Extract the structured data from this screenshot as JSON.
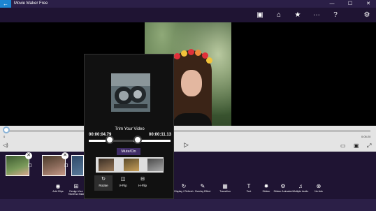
{
  "window": {
    "title": "Movie Maker Free",
    "back_glyph": "←",
    "minimize_glyph": "—",
    "maximize_glyph": "☐",
    "close_glyph": "✕"
  },
  "toolbar": {
    "icons": [
      "save-icon",
      "home-icon",
      "star-icon",
      "more-icon",
      "help-icon",
      "settings-icon"
    ],
    "glyphs": [
      "▣",
      "⌂",
      "★",
      "···",
      "?",
      "⚙"
    ]
  },
  "timeline": {
    "time_left": "0",
    "time_right": "0:05:20",
    "volume_glyph": "◁)",
    "play_glyph": "▷",
    "right_glyphs": [
      "▭",
      "▣",
      "⤢"
    ]
  },
  "clips": {
    "close_glyph": "✕",
    "copy_glyph": "❐",
    "add_clips_label": "Add Clips",
    "add_clips_glyph": "◉",
    "design_label": "Design Your Title/End Slide",
    "design_glyph": "⊞"
  },
  "bottom_toolbar": {
    "items": [
      {
        "glyph": "↻",
        "label": "Display / Refresh"
      },
      {
        "glyph": "✎",
        "label": "Overlay Effect"
      },
      {
        "glyph": "▦",
        "label": "Transition"
      },
      {
        "glyph": "T",
        "label": "Text"
      },
      {
        "glyph": "✸",
        "label": "Sticker"
      },
      {
        "glyph": "⚙",
        "label": "Sticker Animated"
      },
      {
        "glyph": "♫",
        "label": "Multiple Audio"
      },
      {
        "glyph": "⊗",
        "label": "No Ads"
      }
    ]
  },
  "trim": {
    "title": "Trim Your Video",
    "start_time": "00:00:04.79",
    "end_time": "00:00:11.13",
    "mute_label": "Mute/On",
    "actions": [
      {
        "glyph": "↻",
        "label": "Rotate"
      },
      {
        "glyph": "◫",
        "label": "V-Flip"
      },
      {
        "glyph": "⊟",
        "label": "H-Flip"
      }
    ]
  },
  "colors": {
    "title_bar": "#2b1f47",
    "toolbar": "#1f1433",
    "accent": "#1d86d1",
    "mute_button": "#3f2c66"
  }
}
